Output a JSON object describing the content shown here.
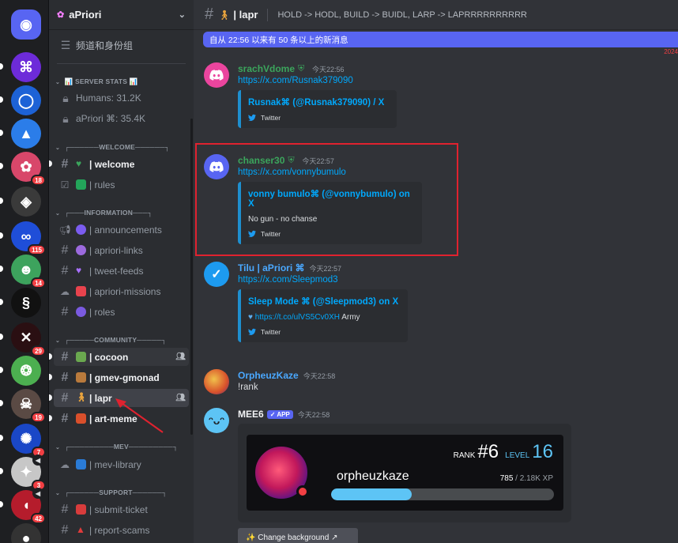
{
  "servers": [
    {
      "name": "discord-home",
      "glyph": "◉",
      "color": "#5865f2",
      "badge": ""
    },
    {
      "name": "server-cmd",
      "glyph": "⌘",
      "color": "#6d2bd9",
      "badge": ""
    },
    {
      "name": "server-ring",
      "glyph": "◯",
      "color": "#1d62d6",
      "badge": ""
    },
    {
      "name": "server-drop",
      "glyph": "▲",
      "color": "#2b7de9",
      "badge": ""
    },
    {
      "name": "server-flower",
      "glyph": "✿",
      "color": "#d8476a",
      "badge": "18"
    },
    {
      "name": "server-dark",
      "glyph": "◈",
      "color": "#3a3a3a",
      "badge": ""
    },
    {
      "name": "server-blue",
      "glyph": "∞",
      "color": "#1f4ed8",
      "badge": "115"
    },
    {
      "name": "server-green",
      "glyph": "☻",
      "color": "#3da35d",
      "badge": "14"
    },
    {
      "name": "server-swirl",
      "glyph": "§",
      "color": "#111111",
      "badge": ""
    },
    {
      "name": "server-net",
      "glyph": "✕",
      "color": "#2a0f12",
      "badge": "29"
    },
    {
      "name": "server-lime",
      "glyph": "❂",
      "color": "#4caf50",
      "badge": ""
    },
    {
      "name": "server-skull",
      "glyph": "☠",
      "color": "#5a4a44",
      "badge": "19"
    },
    {
      "name": "server-galaxy",
      "glyph": "✺",
      "color": "#1a47c7",
      "badge": "7"
    },
    {
      "name": "server-hero",
      "glyph": "✦",
      "color": "#c7c7c7",
      "badge": "3"
    },
    {
      "name": "server-mouth",
      "glyph": "◖",
      "color": "#b51c2c",
      "badge": "42"
    },
    {
      "name": "server-bottom",
      "glyph": "●",
      "color": "#333333",
      "badge": ""
    }
  ],
  "sidebar": {
    "server_name": "aPriori",
    "roles_label": "频道和身份组",
    "stats_header": "📊 SERVER STATS 📊",
    "stats": [
      "Humans: 31.2K",
      "aPriori ⌘: 35.4K"
    ],
    "categories": {
      "welcome": "┌──────WELCOME──────┐",
      "information": "┌───INFORMATION───┐",
      "community": "┌─────COMMUNITY─────┐",
      "mev": "┌─────────MEV─────────┐",
      "support": "┌──────SUPPORT──────┐"
    },
    "channels": {
      "welcome": "| welcome",
      "rules": "| rules",
      "announcements": "| announcements",
      "apriori_links": "| apriori-links",
      "tweet_feeds": "| tweet-feeds",
      "apriori_missions": "| apriori-missions",
      "roles": "| roles",
      "cocoon": "| cocoon",
      "gmev": "| gmev-gmonad",
      "lapr": "| lapr",
      "art_meme": "| art-meme",
      "mev_library": "| mev-library",
      "submit_ticket": "| submit-ticket",
      "report_scams": "| report-scams"
    }
  },
  "header": {
    "channel_name": "| lapr",
    "topic": "HOLD -> HODL, BUILD -> BUIDL, LARP -> LAPRRRRRRRRRR"
  },
  "new_messages_bar": "自从 22:56 以来有 50 条以上的新消息",
  "date_fragment": "2024",
  "messages": [
    {
      "author": "srachVdome",
      "time": "今天22:56",
      "link": "https://x.com/Rusnak379090",
      "embed": {
        "title": "Rusnak⌘ (@Rusnak379090) / X",
        "desc": "",
        "footer": "Twitter"
      }
    },
    {
      "author": "chanser30",
      "time": "今天22:57",
      "link": "https://x.com/vonnybumulo",
      "embed": {
        "title": "vonny bumulo⌘ (@vonnybumulo) on X",
        "desc": "No gun - no chanse",
        "footer": "Twitter"
      }
    },
    {
      "author": "Tilu | aPriori ⌘",
      "time": "今天22:57",
      "link": "https://x.com/Sleepmod3",
      "embed": {
        "title": "Sleep Mode ⌘ (@Sleepmod3) on X",
        "desc_link": "https://t.co/ulVS5Cv0XH",
        "desc_tail": " Army",
        "footer": "Twitter"
      }
    },
    {
      "author": "OrpheuzKaze",
      "time": "今天22:58",
      "text": "!rank"
    },
    {
      "author": "MEE6",
      "app_badge": "✓ APP",
      "time": "今天22:58"
    }
  ],
  "rank_card": {
    "username": "orpheuzkaze",
    "rank_label": "RANK",
    "rank_value": "#6",
    "level_label": "LEVEL",
    "level_value": "16",
    "xp_current": "785",
    "xp_sep": "/",
    "xp_total": "2.18K XP",
    "progress": 0.36
  },
  "change_background_button": "✨ Change background ↗",
  "colors": {
    "accent": "#5865f2",
    "link": "#00a8fc",
    "highlight_box": "#e0222f",
    "progress": "#5dc4f5"
  }
}
